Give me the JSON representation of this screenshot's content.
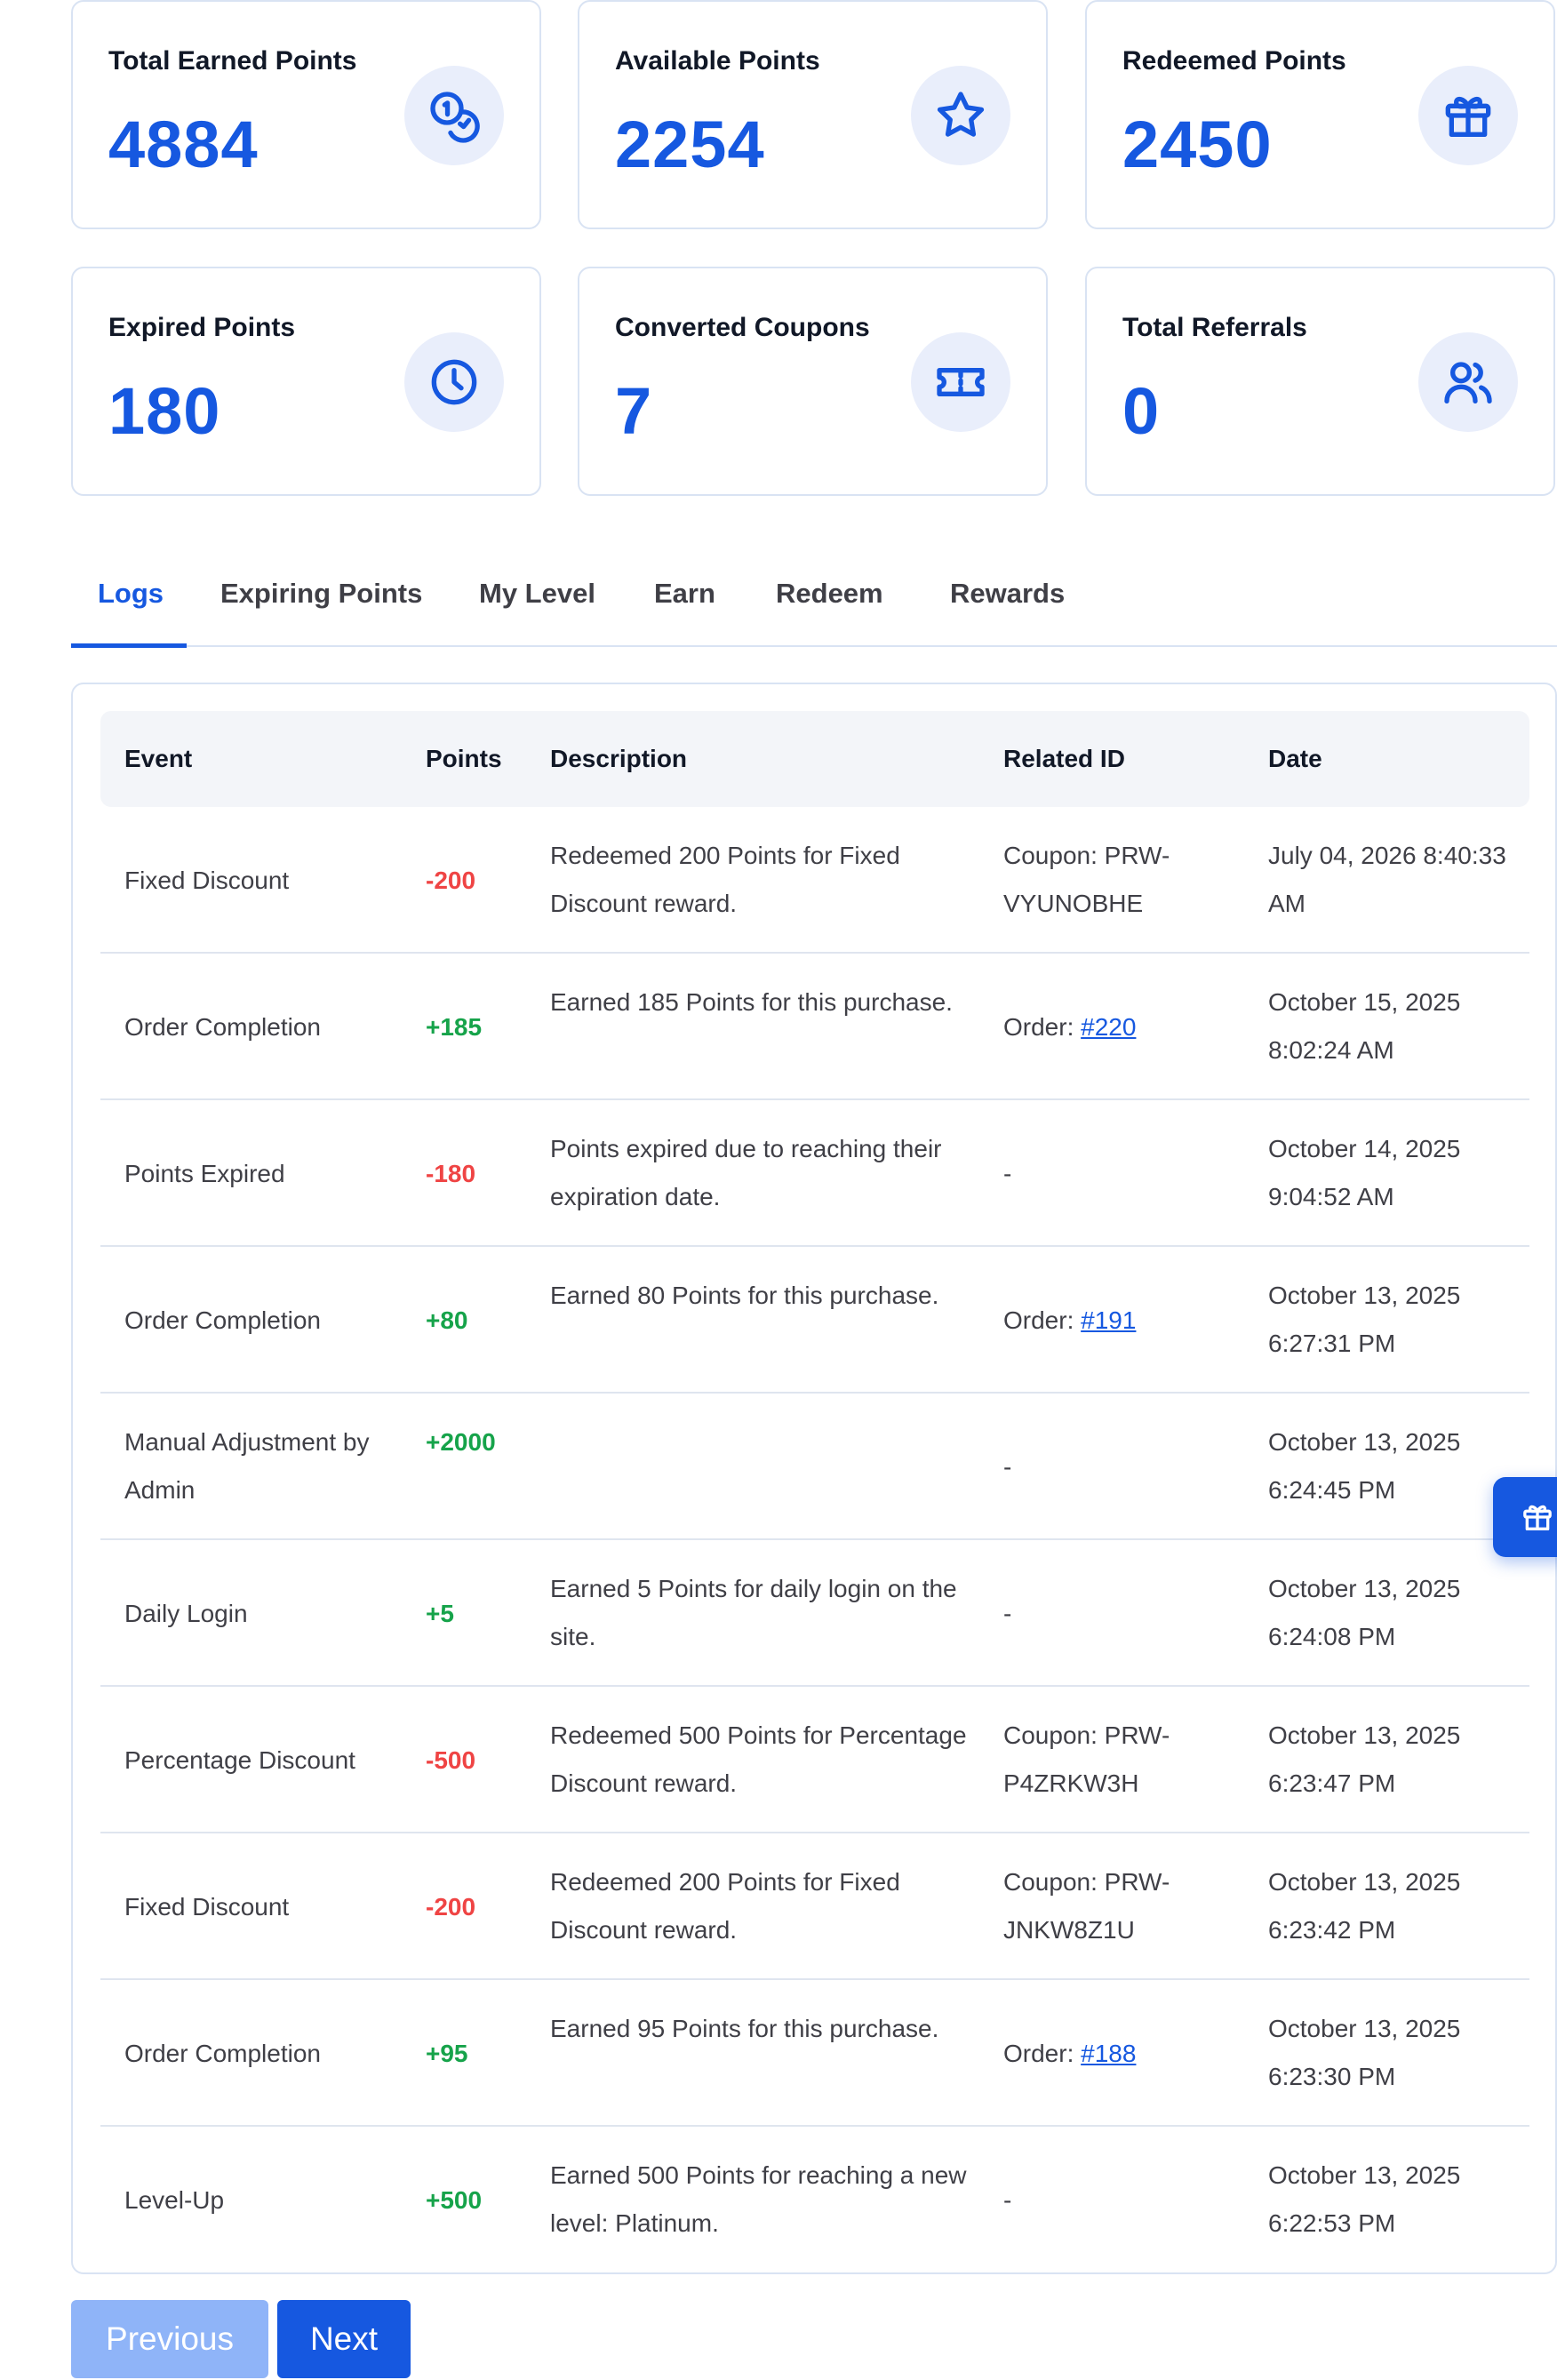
{
  "stats": [
    {
      "label": "Total Earned Points",
      "value": "4884",
      "icon": "coins-icon"
    },
    {
      "label": "Available Points",
      "value": "2254",
      "icon": "star-icon"
    },
    {
      "label": "Redeemed Points",
      "value": "2450",
      "icon": "gift-icon"
    },
    {
      "label": "Expired Points",
      "value": "180",
      "icon": "clock-icon"
    },
    {
      "label": "Converted Coupons",
      "value": "7",
      "icon": "ticket-icon"
    },
    {
      "label": "Total Referrals",
      "value": "0",
      "icon": "users-icon"
    }
  ],
  "tabs": [
    {
      "label": "Logs",
      "active": true
    },
    {
      "label": "Expiring Points"
    },
    {
      "label": "My Level"
    },
    {
      "label": "Earn"
    },
    {
      "label": "Redeem"
    },
    {
      "label": "Rewards"
    }
  ],
  "table": {
    "headers": [
      "Event",
      "Points",
      "Description",
      "Related ID",
      "Date"
    ],
    "rows": [
      {
        "event": "Fixed Discount",
        "points": "-200",
        "description": "Redeemed 200 Points for Fixed Discount reward.",
        "related": "Coupon: PRW-VYUNOBHE",
        "date": "July 04, 2026 8:40:33 AM"
      },
      {
        "event": "Order Completion",
        "points": "+185",
        "description": "Earned 185 Points for this purchase.",
        "related_prefix": "Order: ",
        "related_link": "#220",
        "date": "October 15, 2025 8:02:24 AM"
      },
      {
        "event": "Points Expired",
        "points": "-180",
        "description": "Points expired due to reaching their expiration date.",
        "related": "-",
        "date": "October 14, 2025 9:04:52 AM"
      },
      {
        "event": "Order Completion",
        "points": "+80",
        "description": "Earned 80 Points for this purchase.",
        "related_prefix": "Order: ",
        "related_link": "#191",
        "date": "October 13, 2025 6:27:31 PM"
      },
      {
        "event": "Manual Adjustment by Admin",
        "points": "+2000",
        "description": "",
        "related": "-",
        "date": "October 13, 2025 6:24:45 PM"
      },
      {
        "event": "Daily Login",
        "points": "+5",
        "description": "Earned 5 Points for daily login on the site.",
        "related": "-",
        "date": "October 13, 2025 6:24:08 PM"
      },
      {
        "event": "Percentage Discount",
        "points": "-500",
        "description": "Redeemed 500 Points for Percentage Discount reward.",
        "related": "Coupon: PRW-P4ZRKW3H",
        "date": "October 13, 2025 6:23:47 PM"
      },
      {
        "event": "Fixed Discount",
        "points": "-200",
        "description": "Redeemed 200 Points for Fixed Discount reward.",
        "related": "Coupon: PRW-JNKW8Z1U",
        "date": "October 13, 2025 6:23:42 PM"
      },
      {
        "event": "Order Completion",
        "points": "+95",
        "description": "Earned 95 Points for this purchase.",
        "related_prefix": "Order: ",
        "related_link": "#188",
        "date": "October 13, 2025 6:23:30 PM"
      },
      {
        "event": "Level-Up",
        "points": "+500",
        "description": "Earned 500 Points for reaching a new level: Platinum.",
        "related": "-",
        "date": "October 13, 2025 6:22:53 PM"
      }
    ]
  },
  "pagination": {
    "previous_label": "Previous",
    "next_label": "Next"
  },
  "colors": {
    "accent": "#1658e0",
    "positive": "#16a34a",
    "negative": "#ef4444"
  }
}
